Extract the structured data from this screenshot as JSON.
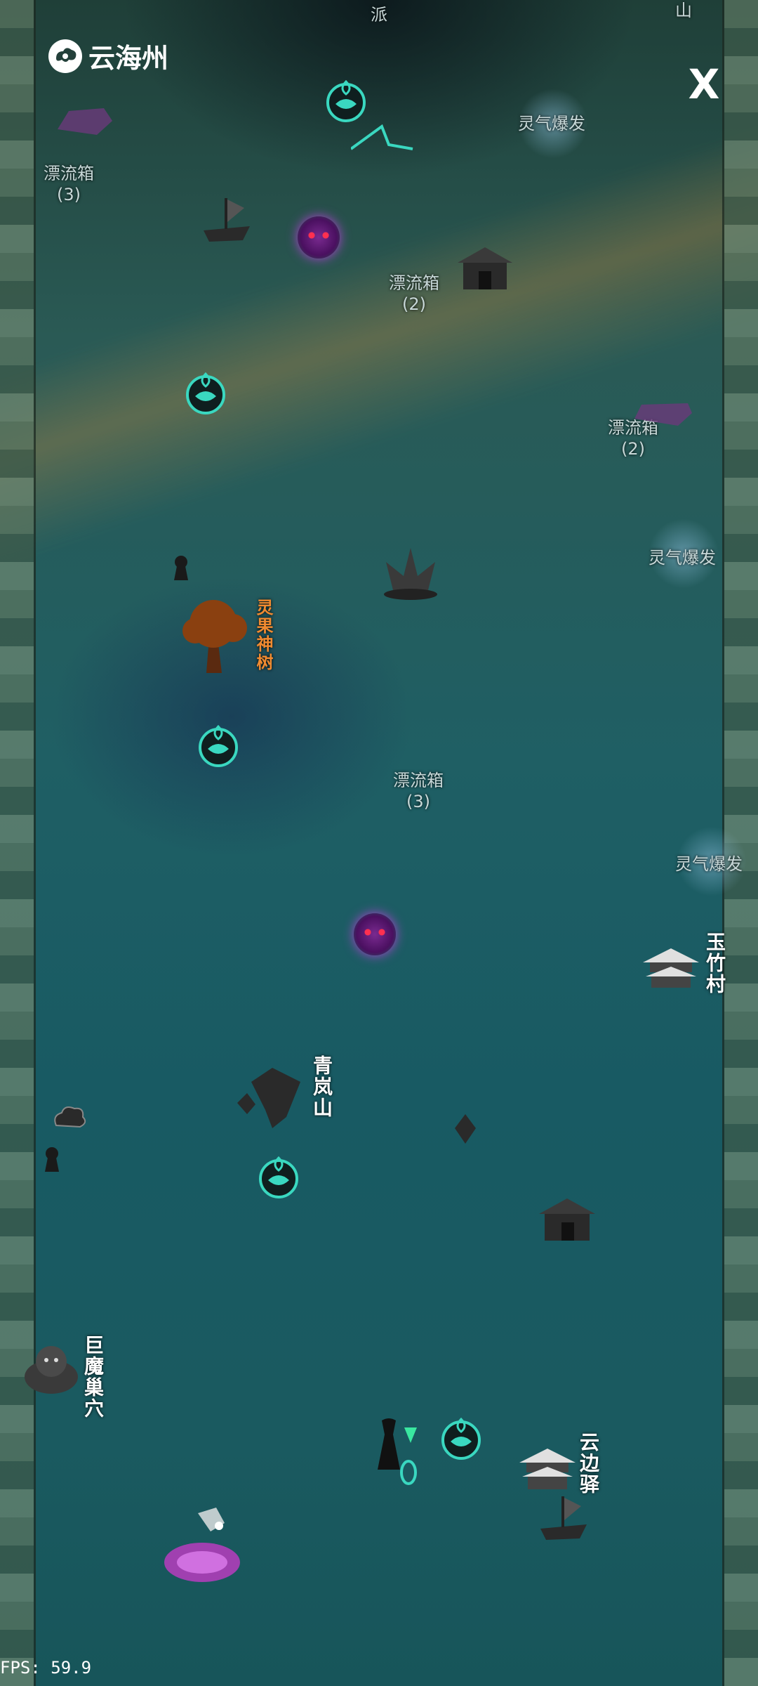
{
  "header": {
    "region_name": "云海州",
    "logo_icon": "cloud-icon",
    "close_label": "X"
  },
  "top_cutoff_labels": {
    "left": "派",
    "right": "山"
  },
  "drift_boxes": [
    {
      "name": "漂流箱",
      "count": "(3)"
    },
    {
      "name": "漂流箱",
      "count": "(2)"
    },
    {
      "name": "漂流箱",
      "count": "(2)"
    },
    {
      "name": "漂流箱",
      "count": "(3)"
    }
  ],
  "bursts": [
    "灵气爆发",
    "灵气爆发",
    "灵气爆发"
  ],
  "locations": {
    "tree": "灵果神树",
    "village": "玉竹村",
    "mountain": "青岚山",
    "lair": "巨魔巢穴",
    "station": "云边驿"
  },
  "fps": "FPS: 59.9",
  "colors": {
    "portal": "#3ad8c0",
    "demon": "#b040d0",
    "tree_label": "#f08a30"
  }
}
